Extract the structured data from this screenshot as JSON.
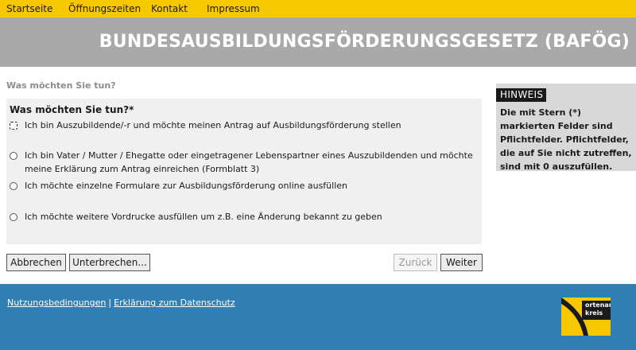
{
  "nav": {
    "items": [
      "Startseite",
      "Öffnungszeiten",
      "Kontakt",
      "Impressum"
    ]
  },
  "banner": {
    "title": "BUNDESAUSBILDUNGSFÖRDERUNGSGESETZ (BAFÖG)"
  },
  "page": {
    "question": "Was möchten Sie tun?"
  },
  "form": {
    "label": "Was möchten Sie tun?*",
    "options": [
      "Ich bin Auszubildende/-r und möchte meinen Antrag auf Ausbildungsförderung stellen",
      "Ich bin Vater / Mutter / Ehegatte oder eingetragener Lebenspartner eines Auszubildenden und möchte meine Erklärung zum Antrag einreichen (Formblatt 3)",
      "Ich möchte einzelne Formulare zur Ausbildungsförderung online ausfüllen",
      "Ich möchte weitere Vordrucke ausfüllen um z.B. eine Änderung bekannt zu geben"
    ]
  },
  "buttons": {
    "cancel": "Abbrechen",
    "interrupt": "Unterbrechen...",
    "back": "Zurück",
    "next": "Weiter"
  },
  "sidebar": {
    "heading": "HINWEIS",
    "text": "Die mit Stern (*) markierten Felder sind Pflichtfelder. Pflichtfelder, die auf Sie nicht zutreffen, sind mit 0 auszufüllen."
  },
  "footer": {
    "terms": "Nutzungsbedingungen",
    "separator": "|",
    "privacy": "Erklärung zum Datenschutz"
  },
  "logo": {
    "line1": "ortenau",
    "line2": "kreis"
  },
  "colors": {
    "nav_yellow": "#f7c800",
    "banner_gray": "#a9a9a9",
    "footer_blue": "#2f7fb5"
  }
}
